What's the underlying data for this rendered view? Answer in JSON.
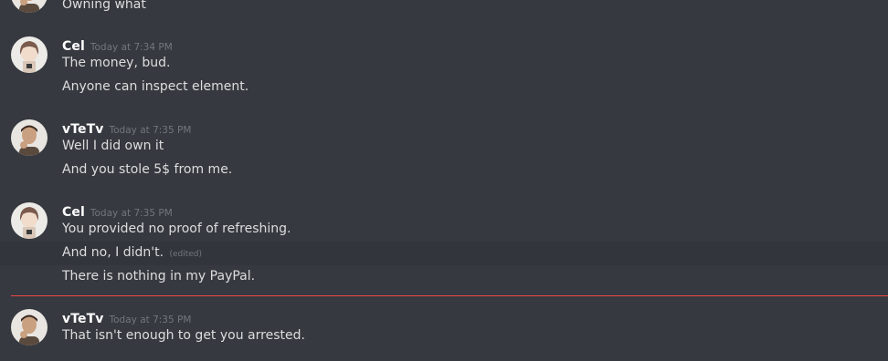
{
  "messages": {
    "partial": {
      "text": "Owning what"
    },
    "g1": {
      "username": "Cel",
      "timestamp": "Today at 7:34 PM",
      "lines": [
        "The money, bud.",
        "Anyone can inspect element."
      ]
    },
    "g2": {
      "username": "vTeTv",
      "timestamp": "Today at 7:35 PM",
      "lines": [
        "Well I did own it",
        "And you stole 5$ from me."
      ]
    },
    "g3": {
      "username": "Cel",
      "timestamp": "Today at 7:35 PM",
      "lines": [
        "You provided no proof of refreshing.",
        "And no, I didn't.",
        "There is nothing in my PayPal."
      ],
      "edited_label": "(edited)"
    },
    "g4": {
      "username": "vTeTv",
      "timestamp": "Today at 7:35 PM",
      "lines": [
        "That isn't enough to get you arrested."
      ]
    }
  },
  "theme": {
    "background": "#36393f",
    "new_messages_divider": "#f04747",
    "username_color": "#ffffff",
    "timestamp_color": "#72767d"
  }
}
